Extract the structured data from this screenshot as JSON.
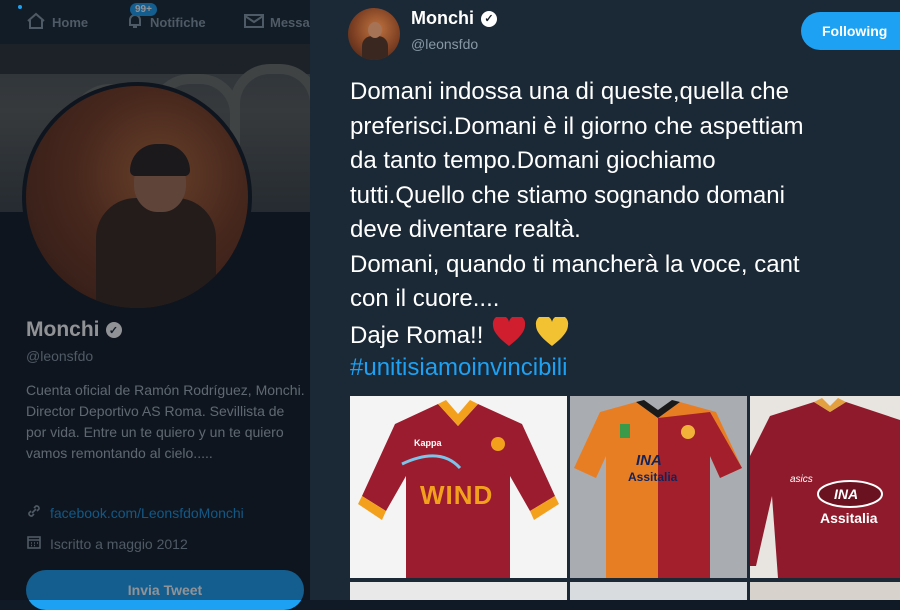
{
  "nav": {
    "home": "Home",
    "notifications": "Notifiche",
    "notif_badge": "99+",
    "messages": "Messa"
  },
  "profile": {
    "name": "Monchi",
    "handle": "@leonsfdo",
    "bio": "Cuenta oficial de Ramón Rodríguez, Monchi. Director Deportivo AS Roma. Sevillista de por vida. Entre un te quiero y un te quiero vamos remontando al cielo.....",
    "link": "facebook.com/LeonsfdoMonchi",
    "joined": "Iscritto a maggio 2012",
    "tweet_button": "Invia Tweet"
  },
  "tweet": {
    "author_name": "Monchi",
    "author_handle": "@leonsfdo",
    "follow_label": "Following",
    "lines": [
      "Domani indossa una di queste,quella che",
      "preferisci.Domani è il giorno che aspettiam",
      "da tanto tempo.Domani giochiamo",
      "tutti.Quello che stiamo sognando domani",
      "deve diventare realtà.",
      "Domani, quando ti mancherà la voce, cant",
      "con il cuore...."
    ],
    "closing": "Daje Roma!!",
    "hashtag": "#unitisiamoinvincibili"
  },
  "media": {
    "jersey1": {
      "brand": "Kappa",
      "sponsor": "WIND"
    },
    "jersey2": {
      "sponsor_top": "INA",
      "sponsor_bottom": "Assitalia"
    },
    "jersey3": {
      "brand": "asics",
      "sponsor_top": "INA",
      "sponsor_bottom": "Assitalia"
    }
  },
  "colors": {
    "accent": "#1da1f2",
    "modal_bg": "#1b2836",
    "roma_red": "#8b1a2b",
    "roma_orange": "#f0a030"
  }
}
